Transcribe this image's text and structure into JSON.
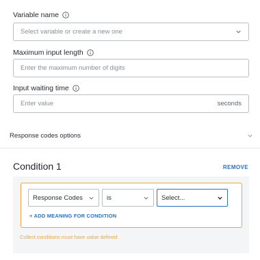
{
  "variable_name": {
    "label": "Variable name",
    "placeholder": "Select variable or create a new one"
  },
  "max_input_length": {
    "label": "Maximum input length",
    "placeholder": "Enter the maximum number of digits"
  },
  "input_waiting_time": {
    "label": "Input waiting time",
    "placeholder": "Enter value",
    "suffix": "seconds"
  },
  "response_codes_options": {
    "label": "Response codes options"
  },
  "condition": {
    "title": "Condition 1",
    "remove_label": "REMOVE",
    "field_select": "Response Codes",
    "operator_select": "is",
    "value_select": "Select...",
    "add_meaning_label": "+ ADD MEANING FOR CONDITION",
    "error_text": "Collect conditions must have value defined"
  },
  "colors": {
    "accent": "#2a6fc4",
    "warning": "#f0a33a",
    "panel_bg": "#f4f5f7"
  },
  "icons": {
    "info": "info-circle-icon",
    "dropdown": "chevron-down-icon"
  }
}
